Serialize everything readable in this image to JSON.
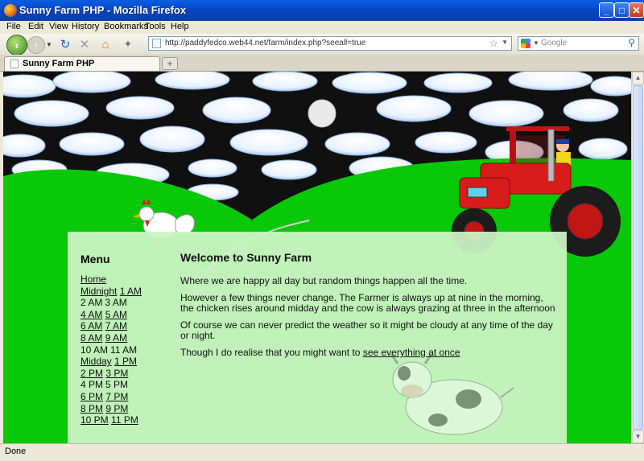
{
  "window": {
    "title": "Sunny Farm PHP - Mozilla Firefox"
  },
  "menubar": [
    "File",
    "Edit",
    "View",
    "History",
    "Bookmarks",
    "Tools",
    "Help"
  ],
  "nav": {
    "url": "http://paddyfedco.web44.net/farm/index.php?seeall=true",
    "search_placeholder": "Google"
  },
  "tab": {
    "title": "Sunny Farm PHP"
  },
  "page": {
    "menu_title": "Menu",
    "home": "Home",
    "times": [
      [
        "Midnight",
        "1 AM"
      ],
      [
        "2 AM",
        "3 AM"
      ],
      [
        "4 AM",
        "5 AM"
      ],
      [
        "6 AM",
        "7 AM"
      ],
      [
        "8 AM",
        "9 AM"
      ],
      [
        "10 AM",
        "11 AM"
      ],
      [
        "Midday",
        "1 PM"
      ],
      [
        "2 PM",
        "3 PM"
      ],
      [
        "4 PM",
        "5 PM"
      ],
      [
        "6 PM",
        "7 PM"
      ],
      [
        "8 PM",
        "9 PM"
      ],
      [
        "10 PM",
        "11 PM"
      ]
    ],
    "heading": "Welcome to Sunny Farm",
    "p1": "Where we are happy all day but random things happen all the time.",
    "p2": "However a few things never change. The Farmer is always up at nine in the morning, the chicken rises around midday and the cow is always grazing at three in the afternoon",
    "p3": "Of course we can never predict the weather so it might be cloudy at any time of the day or night.",
    "p4_prefix": "Though I do realise that you might want to ",
    "p4_link": "see everything at once"
  },
  "status": {
    "text": "Done"
  },
  "colors": {
    "grass": "#08c808",
    "content_bg": "#cdf4c6",
    "sky": "#111111"
  }
}
